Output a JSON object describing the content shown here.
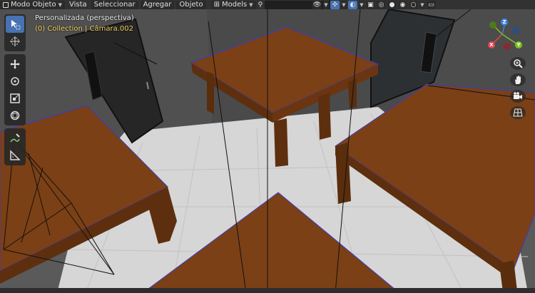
{
  "header": {
    "mode_label": "Modo Objeto",
    "menus": [
      "Vista",
      "Seleccionar",
      "Agregar",
      "Objeto"
    ],
    "orientation_label": "Models",
    "search_placeholder": ""
  },
  "viewport": {
    "title": "Personalizada (perspectiva)",
    "collection_info": "(0) Collection | Câmara.002"
  },
  "gizmo": {
    "axes": [
      "X",
      "Y",
      "Z"
    ],
    "colors": {
      "x": "#e5444f",
      "y": "#7cc31d",
      "z": "#3a84e6"
    }
  },
  "toolbar": {
    "tools": [
      "select-box",
      "cursor",
      "move",
      "rotate",
      "scale",
      "transform",
      "annotate",
      "measure"
    ]
  },
  "colors": {
    "accent": "#4772b3",
    "table_top": "#7a4016",
    "floor": "#d7d7d7",
    "wall": "#555555",
    "door": "#1c1c1c",
    "selection_outline": "#3a3ad6"
  }
}
